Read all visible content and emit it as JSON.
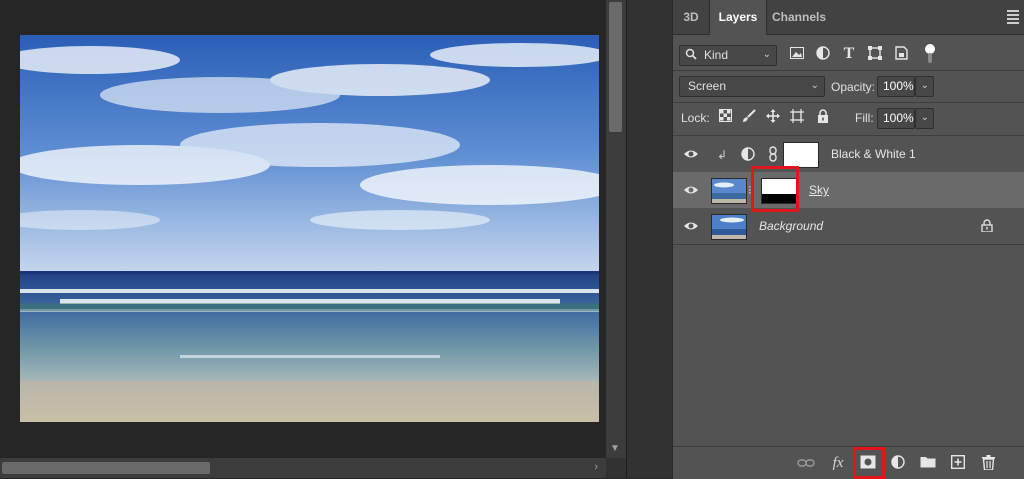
{
  "tabs": [
    {
      "label": "3D"
    },
    {
      "label": "Layers"
    },
    {
      "label": "Channels"
    }
  ],
  "active_tab": "Layers",
  "filter": {
    "kind_label": "Kind",
    "icons": [
      "image-filter-icon",
      "adjustment-filter-icon",
      "type-filter-icon",
      "shape-filter-icon",
      "smart-object-filter-icon"
    ]
  },
  "blend": {
    "mode": "Screen",
    "opacity_label": "Opacity:",
    "opacity_value": "100%",
    "lock_label": "Lock:",
    "fill_label": "Fill:",
    "fill_value": "100%"
  },
  "lock_icons": [
    "lock-transparent-pixels-icon",
    "lock-image-pixels-icon",
    "lock-position-icon",
    "lock-artboard-icon",
    "lock-all-icon"
  ],
  "layers": [
    {
      "name": "Black & White 1",
      "type": "adjustment",
      "clipped": true,
      "visible": true,
      "selected": false
    },
    {
      "name": "Sky",
      "type": "pixel-with-mask",
      "visible": true,
      "selected": true
    },
    {
      "name": "Background",
      "type": "background",
      "visible": true,
      "selected": false,
      "locked": true
    }
  ],
  "footer_icons": [
    "link-layers-icon",
    "fx-icon",
    "add-mask-icon",
    "new-fill-adjustment-icon",
    "new-group-icon",
    "new-layer-icon",
    "delete-layer-icon"
  ],
  "colors": {
    "highlight": "#e0161b",
    "panel_bg": "#535353",
    "selected_row": "#6a6a6a"
  }
}
